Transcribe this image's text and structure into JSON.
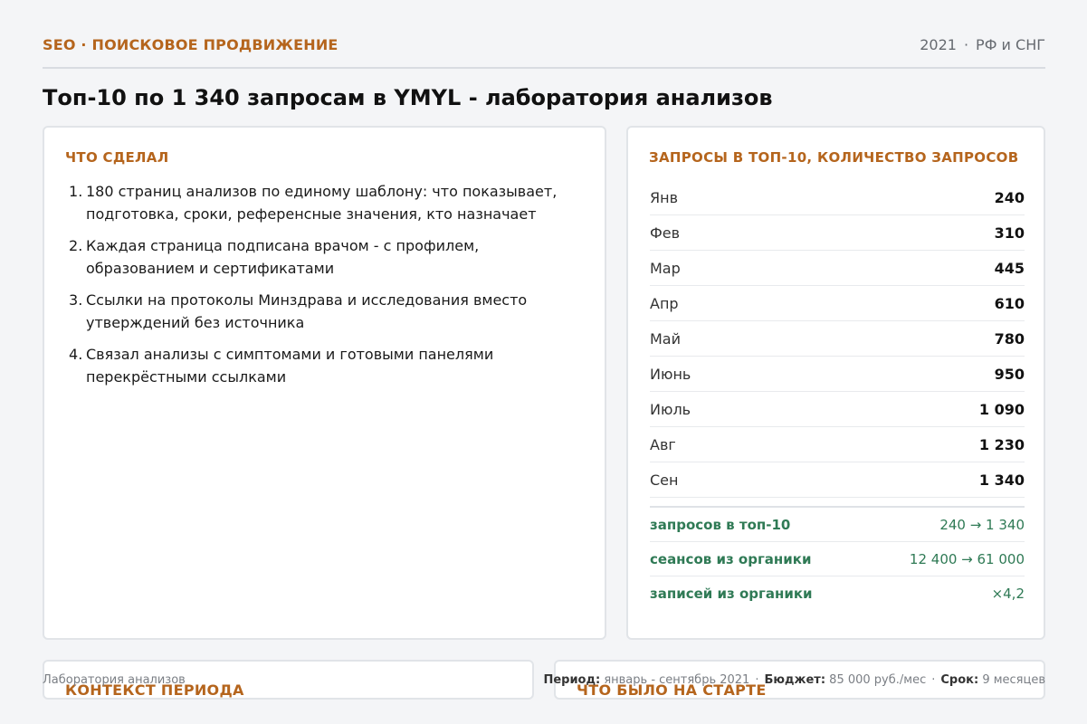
{
  "header": {
    "eyebrow": "SEO · ПОИСКОВОЕ ПРОДВИЖЕНИЕ",
    "year": "2021",
    "region": "РФ и СНГ"
  },
  "title": "Топ-10 по 1 340 запросам в YMYL - лаборатория анализов",
  "did": {
    "heading": "ЧТО СДЕЛАЛ",
    "items": [
      "180 страниц анализов по единому шаблону: что показывает, подготовка, сроки, референсные значения, кто назначает",
      "Каждая страница подписана врачом - с профилем, образованием и сертификатами",
      "Ссылки на протоколы Минздрава и исследования вместо утверждений без источника",
      "Связал анализы с симптомами и готовыми панелями перекрёстными ссылками"
    ]
  },
  "queries": {
    "heading": "ЗАПРОСЫ В ТОП-10, КОЛИЧЕСТВО ЗАПРОСОВ",
    "rows": [
      {
        "month": "Янв",
        "value": "240"
      },
      {
        "month": "Фев",
        "value": "310"
      },
      {
        "month": "Мар",
        "value": "445"
      },
      {
        "month": "Апр",
        "value": "610"
      },
      {
        "month": "Май",
        "value": "780"
      },
      {
        "month": "Июнь",
        "value": "950"
      },
      {
        "month": "Июль",
        "value": "1 090"
      },
      {
        "month": "Авг",
        "value": "1 230"
      },
      {
        "month": "Сен",
        "value": "1 340"
      }
    ],
    "summary": [
      {
        "label": "запросов в топ-10",
        "value": "240 → 1 340"
      },
      {
        "label": "сеансов из органики",
        "value": "12 400 → 61 000"
      },
      {
        "label": "записей из органики",
        "value": "×4,2"
      }
    ]
  },
  "context": {
    "heading": "КОНТЕКСТ ПЕРИОДА"
  },
  "start": {
    "heading": "ЧТО БЫЛО НА СТАРТЕ"
  },
  "footer": {
    "client": "Лаборатория анализов",
    "period_label": "Период:",
    "period_value": "январь - сентябрь 2021",
    "budget_label": "Бюджет:",
    "budget_value": "85 000 руб./мес",
    "term_label": "Срок:",
    "term_value": "9 месяцев"
  },
  "colors": {
    "accent": "#b5651d",
    "positive": "#2f7a55"
  }
}
